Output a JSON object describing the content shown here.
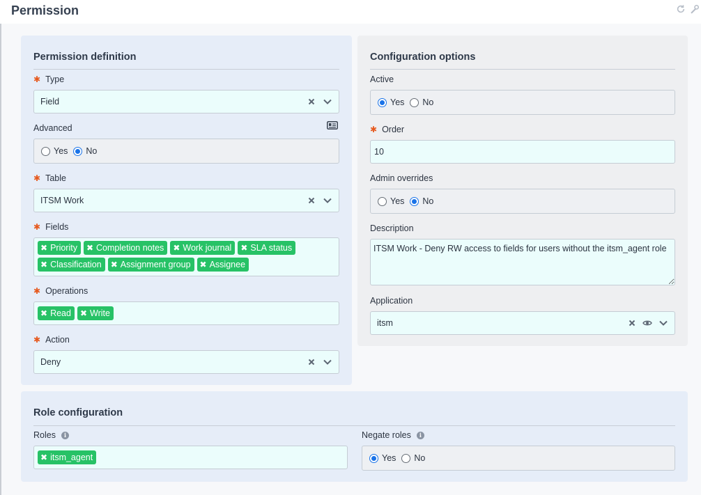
{
  "page": {
    "title": "Permission"
  },
  "header": {
    "refresh_icon": "refresh-icon",
    "wrench_icon": "wrench-icon"
  },
  "definition": {
    "title": "Permission definition",
    "type": {
      "label": "Type",
      "value": "Field",
      "required": true
    },
    "advanced": {
      "label": "Advanced",
      "options": [
        "Yes",
        "No"
      ],
      "selected": "No",
      "icon": "id-card-icon"
    },
    "table": {
      "label": "Table",
      "value": "ITSM Work",
      "required": true
    },
    "fields": {
      "label": "Fields",
      "required": true,
      "tags": [
        "Priority",
        "Completion notes",
        "Work journal",
        "SLA status",
        "Classification",
        "Assignment group",
        "Assignee"
      ]
    },
    "operations": {
      "label": "Operations",
      "required": true,
      "tags": [
        "Read",
        "Write"
      ]
    },
    "action": {
      "label": "Action",
      "value": "Deny",
      "required": true
    }
  },
  "config": {
    "title": "Configuration options",
    "active": {
      "label": "Active",
      "options": [
        "Yes",
        "No"
      ],
      "selected": "Yes"
    },
    "order": {
      "label": "Order",
      "value": "10",
      "required": true
    },
    "admin_overrides": {
      "label": "Admin overrides",
      "options": [
        "Yes",
        "No"
      ],
      "selected": "No"
    },
    "description": {
      "label": "Description",
      "value": "ITSM Work - Deny RW access to fields for users without the itsm_agent role"
    },
    "application": {
      "label": "Application",
      "value": "itsm"
    }
  },
  "roles": {
    "title": "Role configuration",
    "roles": {
      "label": "Roles",
      "tags": [
        "itsm_agent"
      ]
    },
    "negate": {
      "label": "Negate roles",
      "options": [
        "Yes",
        "No"
      ],
      "selected": "Yes"
    }
  },
  "colors": {
    "tag": "#27c266",
    "required": "#e65a1f",
    "radio": "#1a73e8",
    "field_bg": "#ebfdfc"
  }
}
